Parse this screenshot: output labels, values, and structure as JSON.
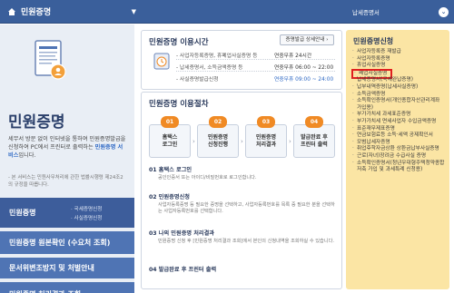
{
  "topbar": {
    "title": "민원증명",
    "right_label": "납세증명서"
  },
  "left": {
    "title": "민원증명",
    "desc_part1": "세무서 방문 없이 인터넷을 통하여 민원증명발급을 신청하여 PC에서 프린터로 출력하는",
    "desc_highlight": "민원증명 서비스",
    "desc_part2": "입니다.",
    "note": "- 본 서비스는 민원사무처리에 관한 법률시행령 제24조2의 규정을 따릅니다.",
    "menu": [
      {
        "label": "민원증명",
        "sub1": "· 국세증명신청",
        "sub2": "· 사실증명신청"
      },
      {
        "label": "민원증명 원본확인 (수요처 조회)"
      },
      {
        "label": "문서위변조방지 및 처벌안내"
      },
      {
        "label": "민원증명 처리결과 조회"
      }
    ]
  },
  "hours": {
    "title": "민원증명 이용시간",
    "detail_button": "증명발급 상세안내 ›",
    "rows": [
      {
        "name": "- 사업자등록증명, 휴폐업사실증명 등",
        "time": "연중무휴 24시간",
        "blue": false
      },
      {
        "name": "- 납세증명서, 소득금액증명 등",
        "time": "연중무휴 06:00 ~ 22:00",
        "blue": false
      },
      {
        "name": "- 사실증명발급신청",
        "time": "연중무휴 09:00 ~ 24:00",
        "blue": true
      }
    ]
  },
  "procedure": {
    "title": "민원증명 이용절차",
    "steps": [
      {
        "num": "01",
        "line1": "홈택스",
        "line2": "로그인"
      },
      {
        "num": "02",
        "line1": "민원증명",
        "line2": "신청진행"
      },
      {
        "num": "03",
        "line1": "민원증명",
        "line2": "처리결과"
      },
      {
        "num": "04",
        "line1": "발급완료 후",
        "line2": "프린터 출력"
      }
    ],
    "items": [
      {
        "title": "01 홈택스 로그인",
        "desc": "공인인증서 또는 아이디/비밀번호로 로그인합니다."
      },
      {
        "title": "02 민원증명신청",
        "desc": "사업자등록증명 등 필요한 증명을 선택하고, 사업자등록번호를 목록 중 필요한 분을 선택하는 사업자등록번호를 선택합니다."
      },
      {
        "title": "03 나의 민원증명 처리결과",
        "desc": "민원증명 신청 후 [민원증명 처리결과 조회]에서 본인의 신청내역을 조회하실 수 있습니다."
      },
      {
        "title": "04 발급완료 후 프린터 출력",
        "desc": ""
      }
    ]
  },
  "apply": {
    "title": "민원증명신청",
    "items": [
      "사업자등록증 재발급",
      "사업자등록증명",
      "휴업사실증명",
      "폐업사실증명",
      "납세증명서(국세완납증명)",
      "납부내역증명(납세사실증명)",
      "소득금액증명",
      "소득확인증명서(개인종합자산관리계좌 가입용)",
      "부가가치세 과세표준증명",
      "부가가치세 면세사업자 수입금액증명",
      "표준재무제표증명",
      "연금보험료등 소득·세액 공제확인서",
      "모범납세자증명",
      "취업후학자금상환 상환금납부사실증명",
      "근로(자녀)장려금 수급사실 증명",
      "소득확인증명서(청년우대형주택청약종합저축 가입 및 과세특례 신청용)"
    ]
  }
}
